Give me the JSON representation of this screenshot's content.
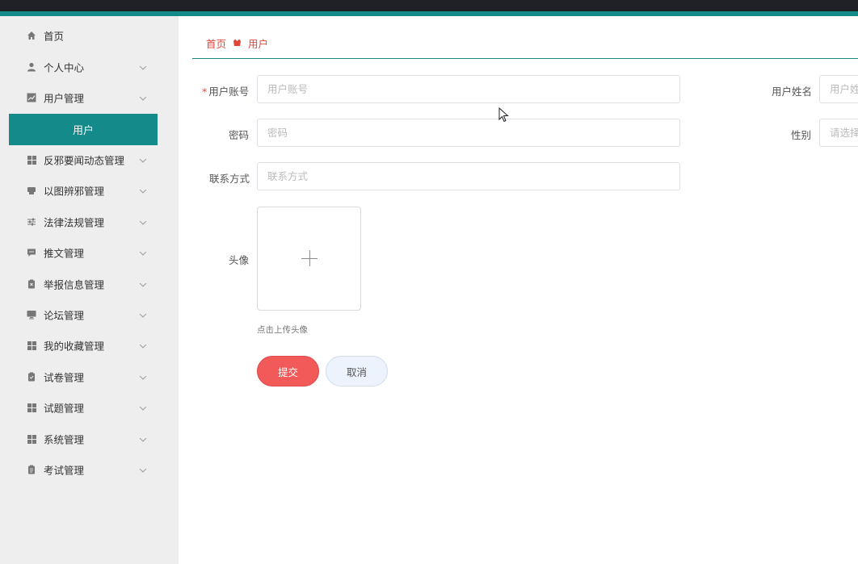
{
  "sidebar": {
    "items": [
      {
        "label": "首页",
        "icon": "home-icon",
        "has_children": false
      },
      {
        "label": "个人中心",
        "icon": "user-icon",
        "has_children": true
      },
      {
        "label": "用户管理",
        "icon": "chart-icon",
        "has_children": true
      },
      {
        "label": "反邪要闻动态管理",
        "icon": "grid-icon",
        "has_children": true
      },
      {
        "label": "以图辨邪管理",
        "icon": "printer-icon",
        "has_children": true
      },
      {
        "label": "法律法规管理",
        "icon": "sliders-icon",
        "has_children": true
      },
      {
        "label": "推文管理",
        "icon": "message-icon",
        "has_children": true
      },
      {
        "label": "举报信息管理",
        "icon": "clipboard-x-icon",
        "has_children": true
      },
      {
        "label": "论坛管理",
        "icon": "monitor-icon",
        "has_children": true
      },
      {
        "label": "我的收藏管理",
        "icon": "grid-icon",
        "has_children": true
      },
      {
        "label": "试卷管理",
        "icon": "clipboard-check-icon",
        "has_children": true
      },
      {
        "label": "试题管理",
        "icon": "grid-icon",
        "has_children": true
      },
      {
        "label": "系统管理",
        "icon": "grid-icon",
        "has_children": true
      },
      {
        "label": "考试管理",
        "icon": "clipboard-icon",
        "has_children": true
      }
    ],
    "active_submenu": "用户"
  },
  "breadcrumb": {
    "home": "首页",
    "current": "用户"
  },
  "form": {
    "account": {
      "label": "用户账号",
      "placeholder": "用户账号",
      "required": true
    },
    "name": {
      "label": "用户姓名",
      "placeholder": "用户姓名"
    },
    "password": {
      "label": "密码",
      "placeholder": "密码"
    },
    "gender": {
      "label": "性别",
      "placeholder": "请选择性别"
    },
    "contact": {
      "label": "联系方式",
      "placeholder": "联系方式"
    },
    "avatar": {
      "label": "头像",
      "tip": "点击上传头像"
    },
    "submit": "提交",
    "cancel": "取消"
  },
  "colors": {
    "accent": "#148a8b",
    "danger": "#f25a5a",
    "breadcrumb": "#e0473b"
  }
}
